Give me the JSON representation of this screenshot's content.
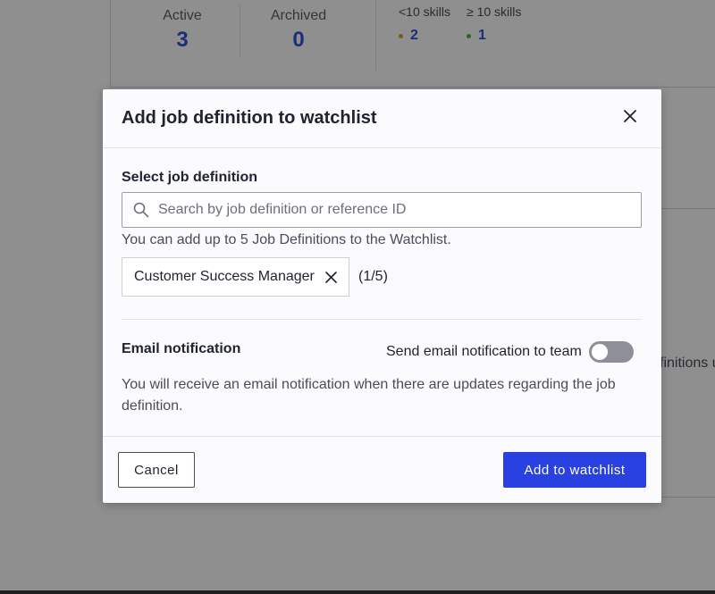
{
  "background": {
    "stats": {
      "active": {
        "label": "Active",
        "value": "3"
      },
      "archived": {
        "label": "Archived",
        "value": "0"
      },
      "skills_low": {
        "label": "<10 skills",
        "value": "2"
      },
      "skills_high": {
        "label": "≥ 10 skills",
        "value": "1"
      }
    },
    "partial_text": "finitions u"
  },
  "modal": {
    "title": "Add job definition to watchlist",
    "close_icon": "close-icon",
    "select_label": "Select job definition",
    "search": {
      "placeholder": "Search by job definition or reference ID",
      "value": "",
      "icon": "search-icon"
    },
    "helper_text": "You can add up to 5 Job Definitions to the Watchlist.",
    "selected": [
      {
        "label": "Customer Success Manager"
      }
    ],
    "count_text": "(1/5)",
    "email": {
      "label": "Email notification",
      "toggle_label": "Send email notification to team",
      "toggle_on": false,
      "description": "You will receive an email notification when there are updates regarding the job definition."
    },
    "footer": {
      "cancel_label": "Cancel",
      "add_label": "Add to watchlist"
    }
  },
  "colors": {
    "primary": "#2941e0",
    "stat_value": "#2f55d4",
    "toggle_off": "#8e9099",
    "dot_low": "#d99a3b",
    "dot_high": "#4caf50"
  }
}
